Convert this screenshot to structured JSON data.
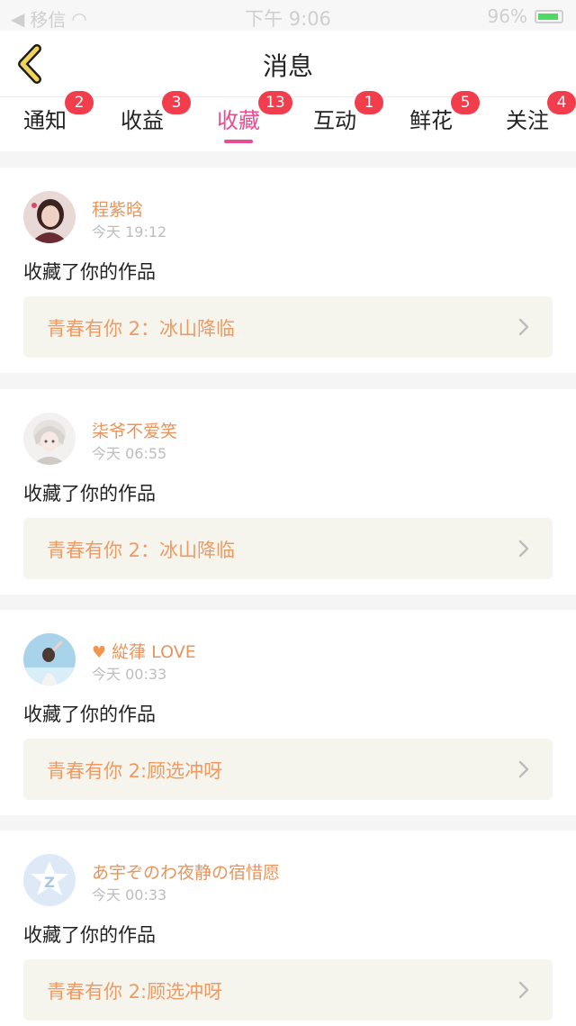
{
  "status_bar": {
    "carrier": "移信",
    "time": "下午 9:06",
    "battery_percent": "96%"
  },
  "header": {
    "title": "消息"
  },
  "tabs": [
    {
      "label": "通知",
      "badge": "2",
      "active": false
    },
    {
      "label": "收益",
      "badge": "3",
      "active": false
    },
    {
      "label": "收藏",
      "badge": "13",
      "active": true
    },
    {
      "label": "互动",
      "badge": "1",
      "active": false
    },
    {
      "label": "鲜花",
      "badge": "5",
      "active": false
    },
    {
      "label": "关注",
      "badge": "4",
      "active": false
    }
  ],
  "colors": {
    "accent": "#e74d8f",
    "badge": "#f23e4c",
    "username": "#e9945c",
    "work_title": "#ef9a62"
  },
  "messages": [
    {
      "user": "程紫晗",
      "time": "今天 19:12",
      "action": "收藏了你的作品",
      "work": "青春有你 2：冰山降临",
      "avatar_icon": "avatar-photo"
    },
    {
      "user": "柒爷不爱笑",
      "time": "今天 06:55",
      "action": "收藏了你的作品",
      "work": "青春有你 2：冰山降临",
      "avatar_icon": "avatar-photo"
    },
    {
      "user": "緃葎 LOVE",
      "time": "今天 00:33",
      "action": "收藏了你的作品",
      "work": "青春有你 2:顾选冲呀",
      "avatar_icon": "avatar-photo",
      "heart": "♥"
    },
    {
      "user": "あ宇ぞのわ夜静の宿惜愿",
      "time": "今天 00:33",
      "action": "收藏了你的作品",
      "work": "青春有你 2:顾选冲呀",
      "avatar_icon": "default-avatar-icon"
    }
  ]
}
